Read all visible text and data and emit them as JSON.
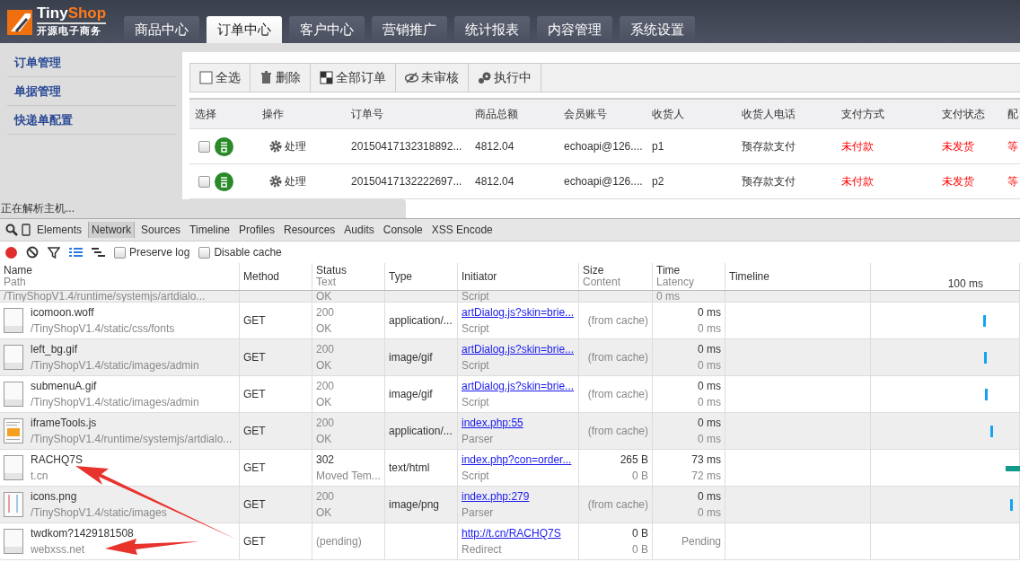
{
  "logo": {
    "title_parts": [
      "Tiny",
      "Shop"
    ],
    "subtitle": "开源电子商务"
  },
  "nav_tabs": [
    {
      "label": "商品中心",
      "selected": false
    },
    {
      "label": "订单中心",
      "selected": true
    },
    {
      "label": "客户中心",
      "selected": false
    },
    {
      "label": "营销推广",
      "selected": false
    },
    {
      "label": "统计报表",
      "selected": false
    },
    {
      "label": "内容管理",
      "selected": false
    },
    {
      "label": "系统设置",
      "selected": false
    }
  ],
  "sidebar": {
    "items": [
      "订单管理",
      "单据管理",
      "快递单配置"
    ]
  },
  "toolbar": [
    {
      "label": "全选",
      "kind": "checkbox"
    },
    {
      "label": "删除",
      "kind": "trash"
    },
    {
      "label": "全部订单",
      "kind": "squares"
    },
    {
      "label": "未审核",
      "kind": "eye"
    },
    {
      "label": "执行中",
      "kind": "gears"
    }
  ],
  "orders": {
    "columns": [
      "选择",
      "操作",
      "订单号",
      "商品总额",
      "会员账号",
      "收货人",
      "收货人电话",
      "支付方式",
      "支付状态",
      "配"
    ],
    "rows": [
      {
        "checked": false,
        "action": "处理",
        "order_no": "20150417132318892...",
        "total": "4812.04",
        "member": "echoapi@126....",
        "consignee": "p1",
        "phone": "预存款支付",
        "pay_method": "未付款",
        "pay_status": "未发货",
        "column_10": "等"
      },
      {
        "checked": false,
        "action": "处理",
        "order_no": "20150417132222697...",
        "total": "4812.04",
        "member": "echoapi@126....",
        "consignee": "p2",
        "phone": "预存款支付",
        "pay_method": "未付款",
        "pay_status": "未发货",
        "column_10": "等"
      }
    ]
  },
  "status_text": "正在解析主机...",
  "devtools": {
    "tabs": [
      {
        "label": "Elements",
        "selected": false
      },
      {
        "label": "Network",
        "selected": true
      },
      {
        "label": "Sources",
        "selected": false
      },
      {
        "label": "Timeline",
        "selected": false
      },
      {
        "label": "Profiles",
        "selected": false
      },
      {
        "label": "Resources",
        "selected": false
      },
      {
        "label": "Audits",
        "selected": false
      },
      {
        "label": "Console",
        "selected": false
      },
      {
        "label": "XSS Encode",
        "selected": false
      }
    ],
    "recording": true,
    "options": [
      {
        "label": "Preserve log",
        "checked": false
      },
      {
        "label": "Disable cache",
        "checked": false
      }
    ],
    "columns": [
      [
        "Name",
        "Path"
      ],
      [
        "Method"
      ],
      [
        "Status",
        "Text"
      ],
      [
        "Type"
      ],
      [
        "Initiator"
      ],
      [
        "Size",
        "Content"
      ],
      [
        "Time",
        "Latency"
      ],
      [
        "Timeline"
      ]
    ],
    "timeline_tick": "100 ms",
    "partial_row": {
      "path": "/TinyShopV1.4/runtime/systemjs/artdialo...",
      "status_text": "OK",
      "initiator_type": "Script",
      "latency": "0 ms"
    },
    "requests": [
      {
        "kind": "file",
        "name": "icomoon.woff",
        "path": "/TinyShopV1.4/static/css/fonts",
        "method": "GET",
        "status": "200",
        "status_text": "OK",
        "status_muted": true,
        "type": "application/...",
        "initiator": "artDialog.js?skin=brie...",
        "initiator_type": "Script",
        "size": "(from cache)",
        "time": "0 ms",
        "latency": "0 ms"
      },
      {
        "kind": "file",
        "name": "left_bg.gif",
        "path": "/TinyShopV1.4/static/images/admin",
        "method": "GET",
        "status": "200",
        "status_text": "OK",
        "status_muted": true,
        "type": "image/gif",
        "initiator": "artDialog.js?skin=brie...",
        "initiator_type": "Script",
        "size": "(from cache)",
        "time": "0 ms",
        "latency": "0 ms"
      },
      {
        "kind": "file",
        "name": "submenuA.gif",
        "path": "/TinyShopV1.4/static/images/admin",
        "method": "GET",
        "status": "200",
        "status_text": "OK",
        "status_muted": true,
        "type": "image/gif",
        "initiator": "artDialog.js?skin=brie...",
        "initiator_type": "Script",
        "size": "(from cache)",
        "time": "0 ms",
        "latency": "0 ms"
      },
      {
        "kind": "script",
        "name": "iframeTools.js",
        "path": "/TinyShopV1.4/runtime/systemjs/artdialo...",
        "method": "GET",
        "status": "200",
        "status_text": "OK",
        "status_muted": true,
        "type": "application/...",
        "initiator": "index.php:55",
        "initiator_type": "Parser",
        "size": "(from cache)",
        "time": "0 ms",
        "latency": "0 ms"
      },
      {
        "kind": "file",
        "name": "RACHQ7S",
        "path": "t.cn",
        "method": "GET",
        "status": "302",
        "status_text": "Moved Tem...",
        "status_muted": false,
        "type": "text/html",
        "initiator": "index.php?con=order...",
        "initiator_type": "Script",
        "size": "265 B",
        "content": "0 B",
        "time": "73 ms",
        "latency": "72 ms"
      },
      {
        "kind": "image",
        "name": "icons.png",
        "path": "/TinyShopV1.4/static/images",
        "method": "GET",
        "status": "200",
        "status_text": "OK",
        "status_muted": true,
        "type": "image/png",
        "initiator": "index.php:279",
        "initiator_type": "Parser",
        "size": "(from cache)",
        "time": "0 ms",
        "latency": "0 ms"
      },
      {
        "kind": "file",
        "name": "twdkom?1429181508",
        "path": "webxss.net",
        "method": "GET",
        "status": "(pending)",
        "status_muted": true,
        "initiator": "http://t.cn/RACHQ7S",
        "initiator_type": "Redirect",
        "size": "0 B",
        "content": "0 B",
        "time": "Pending"
      }
    ]
  }
}
